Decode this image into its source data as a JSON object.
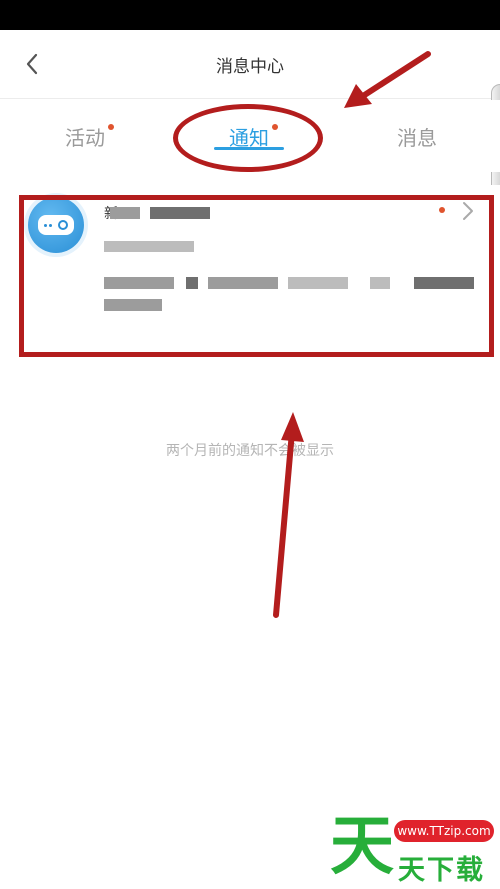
{
  "header": {
    "title": "消息中心",
    "back_icon": "chevron-left-icon"
  },
  "tabs": [
    {
      "label": "活动",
      "unread": true,
      "active": false
    },
    {
      "label": "通知",
      "unread": true,
      "active": true
    },
    {
      "label": "消息",
      "unread": false,
      "active": false
    }
  ],
  "notice": {
    "sender_initial": "新",
    "unread": true
  },
  "empty_hint": "两个月前的通知不会被显示",
  "watermark": {
    "big_char": "天",
    "url": "www.TTzip.com",
    "text": "天下载"
  },
  "colors": {
    "accent": "#2c9fe1",
    "unread_dot": "#e0542e",
    "annotation": "#b31d1d",
    "watermark_green": "#27ae3a",
    "watermark_red": "#e0232c"
  }
}
